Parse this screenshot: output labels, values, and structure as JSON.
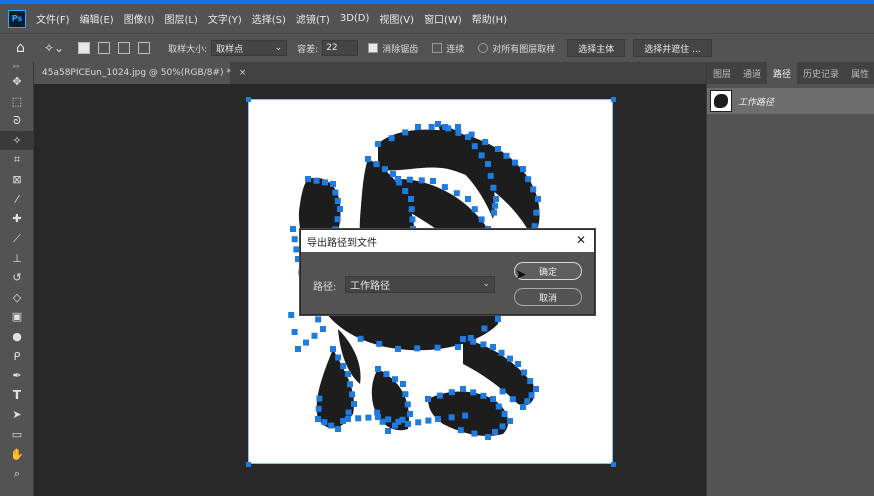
{
  "app": {
    "logo": "Ps"
  },
  "menu": [
    "文件(F)",
    "编辑(E)",
    "图像(I)",
    "图层(L)",
    "文字(Y)",
    "选择(S)",
    "滤镜(T)",
    "3D(D)",
    "视图(V)",
    "窗口(W)",
    "帮助(H)"
  ],
  "options": {
    "sample_size_label": "取样大小:",
    "sample_size_value": "取样点",
    "tolerance_label": "容差:",
    "tolerance_value": "22",
    "antialias_label": "消除锯齿",
    "contiguous_label": "连续",
    "sample_all_label": "对所有图层取样",
    "select_subject_label": "选择主体",
    "select_mask_label": "选择并遮住 ..."
  },
  "document": {
    "tab_title": "45a58PICEun_1024.jpg @ 50%(RGB/8#) *",
    "close_glyph": "×"
  },
  "panel": {
    "tabs": [
      "图层",
      "通道",
      "路径",
      "历史记录",
      "属性"
    ],
    "active_tab": 2,
    "path_item": "工作路径"
  },
  "dialog": {
    "title": "导出路径到文件",
    "path_label": "路径:",
    "path_value": "工作路径",
    "ok_label": "确定",
    "cancel_label": "取消",
    "close_glyph": "✕"
  },
  "colors": {
    "accent": "#1473e6",
    "path_anchor": "#1f7be0",
    "ink": "#1d1d1d"
  },
  "tools": [
    "move-icon",
    "marquee-icon",
    "lasso-icon",
    "magic-wand-icon",
    "crop-icon",
    "frame-icon",
    "eyedropper-icon",
    "healing-icon",
    "brush-icon",
    "stamp-icon",
    "history-brush-icon",
    "eraser-icon",
    "gradient-icon",
    "blur-icon",
    "dodge-icon",
    "pen-icon",
    "type-icon",
    "path-select-icon",
    "rectangle-icon",
    "hand-icon",
    "zoom-icon"
  ]
}
